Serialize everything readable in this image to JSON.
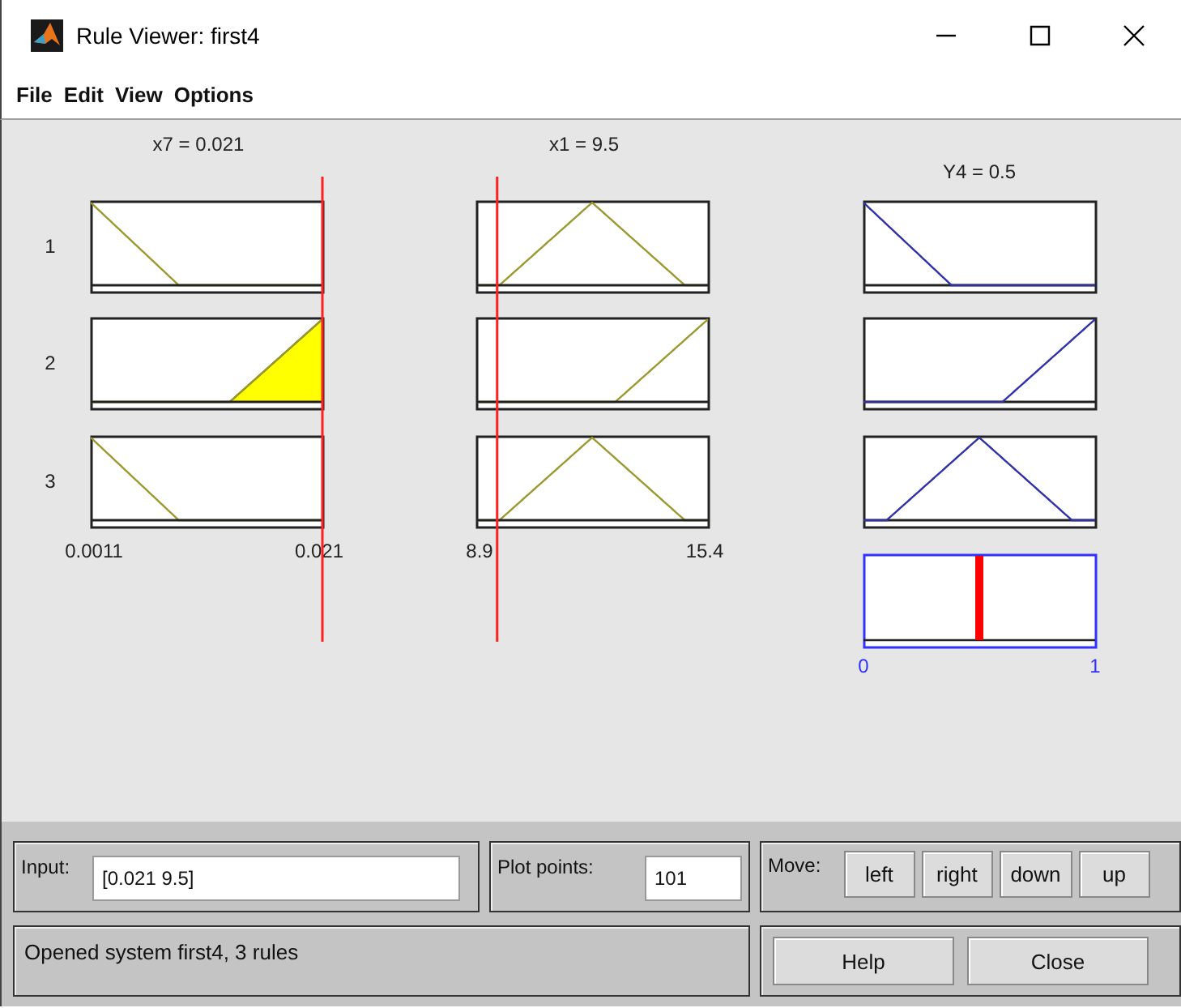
{
  "window": {
    "title": "Rule Viewer: first4"
  },
  "menu": [
    "File",
    "Edit",
    "View",
    "Options"
  ],
  "inputs": [
    {
      "label": "x7 = 0.021",
      "min_label": "0.0011",
      "max_label": "0.021"
    },
    {
      "label": "x1 = 9.5",
      "min_label": "8.9",
      "max_label": "15.4"
    }
  ],
  "output": {
    "label": "Y4 = 0.5",
    "min_label": "0",
    "max_label": "1"
  },
  "rules": [
    {
      "number": "1",
      "cells": [
        {
          "kind": "falling",
          "filled": false
        },
        {
          "kind": "triangle",
          "filled": false
        },
        {
          "kind": "falling",
          "filled": false
        }
      ]
    },
    {
      "number": "2",
      "cells": [
        {
          "kind": "rising",
          "filled": true
        },
        {
          "kind": "rising",
          "filled": false
        },
        {
          "kind": "rising",
          "filled": false
        }
      ]
    },
    {
      "number": "3",
      "cells": [
        {
          "kind": "falling",
          "filled": false
        },
        {
          "kind": "triangle",
          "filled": false
        },
        {
          "kind": "triangle",
          "filled": false
        }
      ]
    }
  ],
  "controls": {
    "input": {
      "label": "Input:",
      "value": "[0.021 9.5]"
    },
    "plot_points": {
      "label": "Plot points:",
      "value": "101"
    },
    "move": {
      "label": "Move:",
      "buttons": [
        "left",
        "right",
        "down",
        "up"
      ]
    },
    "status": "Opened system first4, 3 rules",
    "buttons": [
      "Help",
      "Close"
    ]
  }
}
